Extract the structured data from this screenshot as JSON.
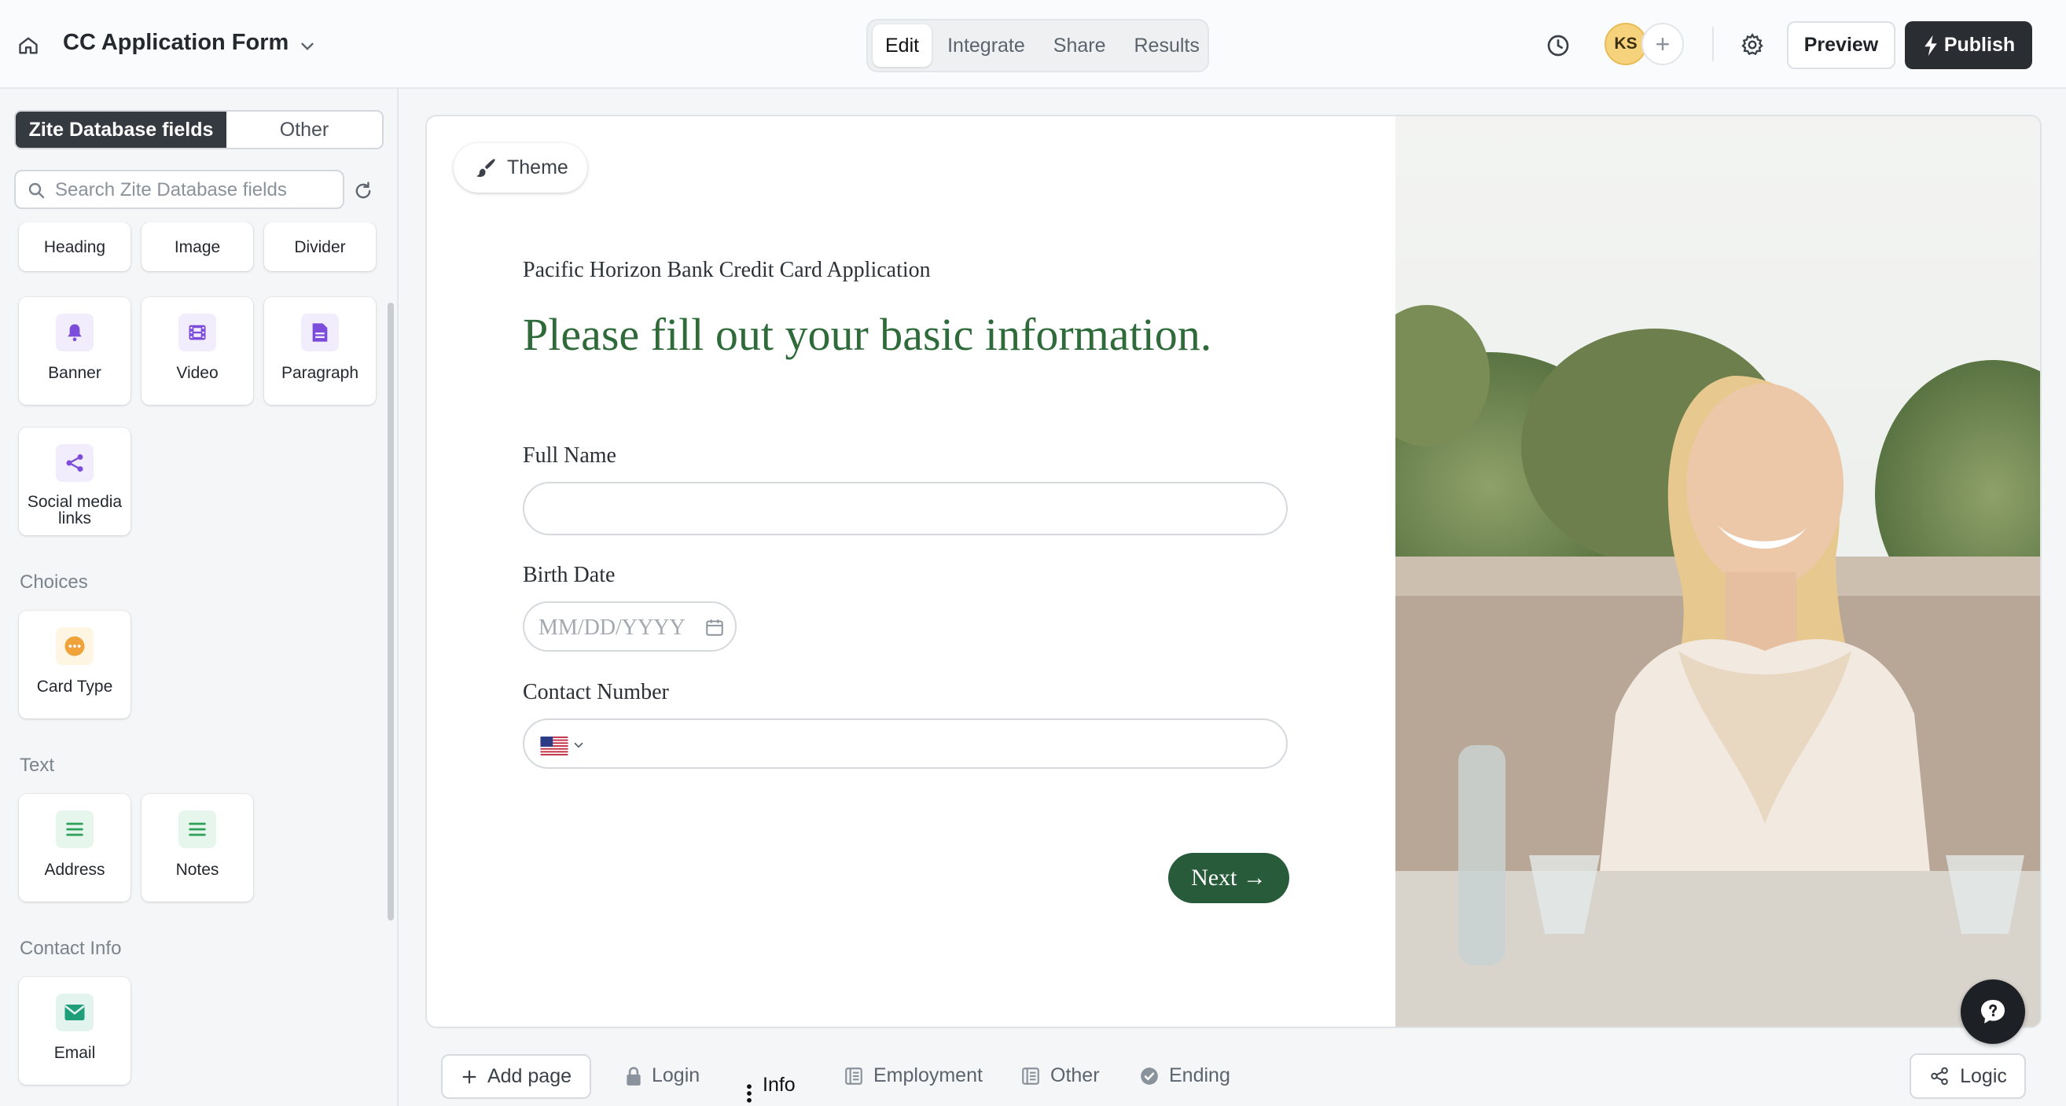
{
  "header": {
    "form_title": "CC Application Form",
    "tabs": [
      {
        "label": "Edit",
        "active": true
      },
      {
        "label": "Integrate",
        "active": false
      },
      {
        "label": "Share",
        "active": false
      },
      {
        "label": "Results",
        "active": false
      }
    ],
    "avatar_initials": "KS",
    "add_collaborator": "+",
    "preview_label": "Preview",
    "publish_label": "Publish"
  },
  "sidebar": {
    "segments": [
      {
        "label": "Zite Database fields",
        "active": true
      },
      {
        "label": "Other",
        "active": false
      }
    ],
    "search_placeholder": "Search Zite Database fields",
    "layout_items": [
      {
        "label": "Heading",
        "icon": "heading-icon"
      },
      {
        "label": "Image",
        "icon": "image-icon"
      },
      {
        "label": "Divider",
        "icon": "divider-icon"
      },
      {
        "label": "Banner",
        "icon": "bell-icon"
      },
      {
        "label": "Video",
        "icon": "film-icon"
      },
      {
        "label": "Paragraph",
        "icon": "document-icon"
      },
      {
        "label": "Social media links",
        "icon": "share-icon"
      }
    ],
    "sections": {
      "choices": "Choices",
      "text": "Text",
      "contact": "Contact Info"
    },
    "choices_items": [
      {
        "label": "Card Type",
        "icon": "ellipsis-circle-icon"
      }
    ],
    "text_items": [
      {
        "label": "Address",
        "icon": "lines-icon"
      },
      {
        "label": "Notes",
        "icon": "lines-icon"
      }
    ],
    "contact_items": [
      {
        "label": "Email",
        "icon": "mail-icon"
      }
    ]
  },
  "canvas": {
    "theme_label": "Theme",
    "overline": "Pacific Horizon Bank Credit Card Application",
    "headline": "Please fill out your basic information.",
    "fields": {
      "full_name": {
        "label": "Full Name",
        "value": ""
      },
      "birth_date": {
        "label": "Birth Date",
        "placeholder": "MM/DD/YYYY"
      },
      "contact_number": {
        "label": "Contact Number",
        "value": "",
        "country": "US"
      }
    },
    "next_label": "Next →",
    "accent_color": "#2f6b3a",
    "button_color": "#275b3a"
  },
  "bottom_bar": {
    "add_page_label": "Add page",
    "pages": [
      {
        "label": "Login",
        "icon": "lock-icon",
        "active": false
      },
      {
        "label": "Info",
        "icon": "drag-handle-icon",
        "active": true
      },
      {
        "label": "Employment",
        "icon": "form-page-icon",
        "active": false
      },
      {
        "label": "Other",
        "icon": "form-page-icon",
        "active": false
      },
      {
        "label": "Ending",
        "icon": "check-circle-icon",
        "active": false
      }
    ],
    "logic_label": "Logic"
  }
}
